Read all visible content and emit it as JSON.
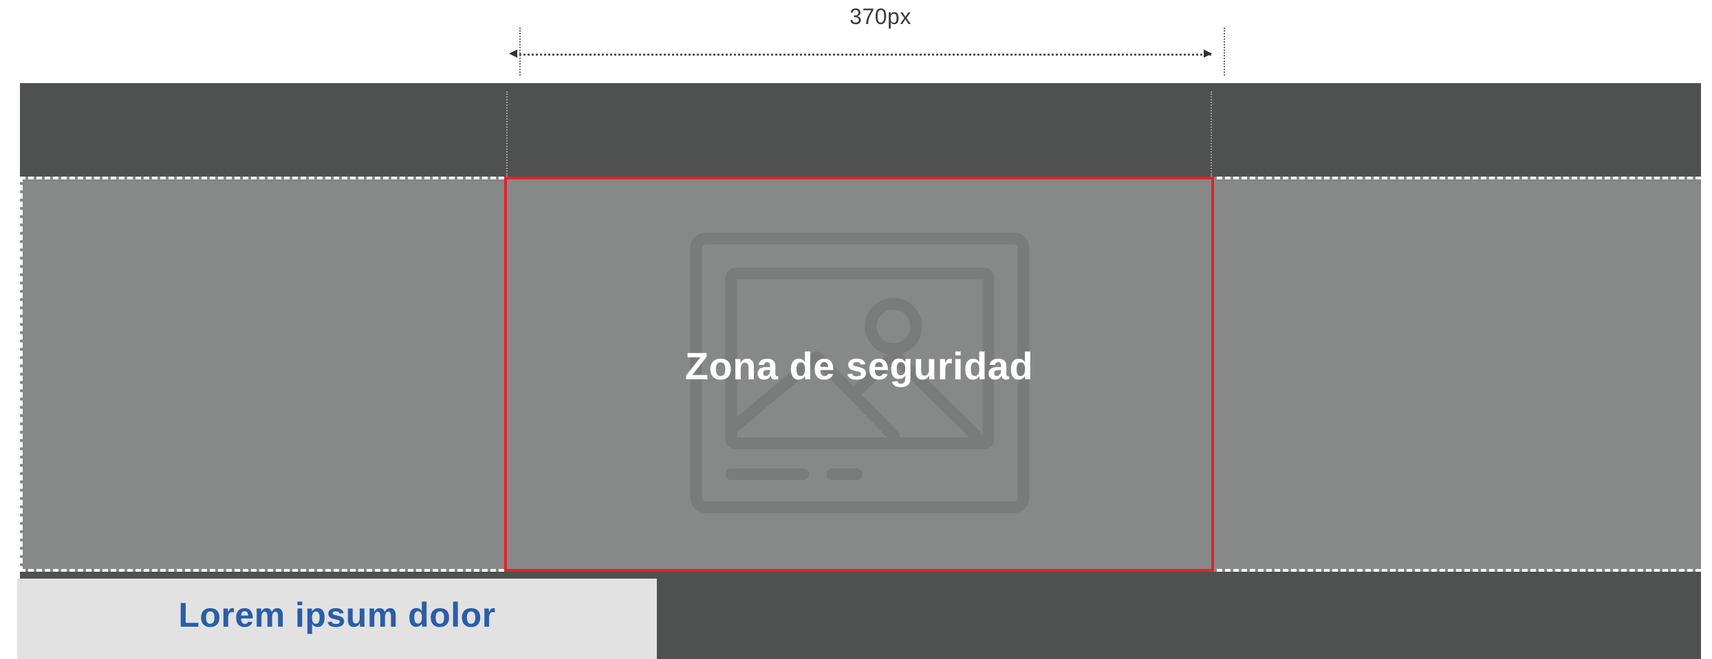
{
  "dimension": {
    "label": "370px"
  },
  "safe_zone": {
    "label": "Zona de seguridad",
    "border_color": "#e3222b"
  },
  "banner": {
    "title": "Lorem ipsum dolor",
    "title_color": "#2a5da8"
  },
  "colors": {
    "dark_band": "#4f5050",
    "image_area": "#878888",
    "title_background": "#e2e2e2"
  },
  "icons": {
    "placeholder": "image-placeholder-icon"
  }
}
